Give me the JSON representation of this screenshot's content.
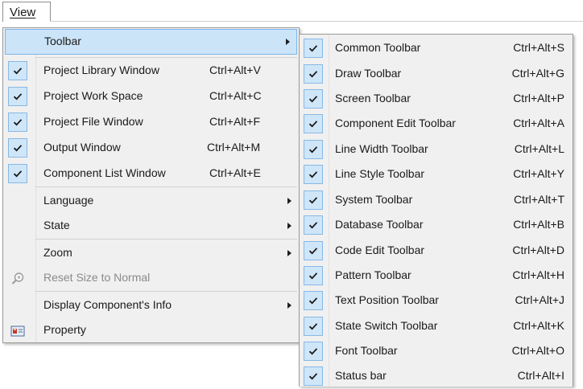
{
  "menubar": {
    "view": "View"
  },
  "main_menu": {
    "toolbar": "Toolbar",
    "items": [
      {
        "label": "Project Library Window",
        "shortcut": "Ctrl+Alt+V"
      },
      {
        "label": "Project Work Space",
        "shortcut": "Ctrl+Alt+C"
      },
      {
        "label": "Project File Window",
        "shortcut": "Ctrl+Alt+F"
      },
      {
        "label": "Output Window",
        "shortcut": "Ctrl+Alt+M"
      },
      {
        "label": "Component List Window",
        "shortcut": "Ctrl+Alt+E"
      }
    ],
    "language": "Language",
    "state": "State",
    "zoom": "Zoom",
    "reset_size": "Reset Size to Normal",
    "display_info": "Display Component's Info",
    "property": "Property"
  },
  "submenu": {
    "items": [
      {
        "label": "Common Toolbar",
        "shortcut": "Ctrl+Alt+S"
      },
      {
        "label": "Draw Toolbar",
        "shortcut": "Ctrl+Alt+G"
      },
      {
        "label": "Screen Toolbar",
        "shortcut": "Ctrl+Alt+P"
      },
      {
        "label": "Component Edit Toolbar",
        "shortcut": "Ctrl+Alt+A"
      },
      {
        "label": "Line Width Toolbar",
        "shortcut": "Ctrl+Alt+L"
      },
      {
        "label": "Line Style Toolbar",
        "shortcut": "Ctrl+Alt+Y"
      },
      {
        "label": "System Toolbar",
        "shortcut": "Ctrl+Alt+T"
      },
      {
        "label": "Database Toolbar",
        "shortcut": "Ctrl+Alt+B"
      },
      {
        "label": "Code Edit Toolbar",
        "shortcut": "Ctrl+Alt+D"
      },
      {
        "label": "Pattern Toolbar",
        "shortcut": "Ctrl+Alt+H"
      },
      {
        "label": "Text Position Toolbar",
        "shortcut": "Ctrl+Alt+J"
      },
      {
        "label": "State Switch Toolbar",
        "shortcut": "Ctrl+Alt+K"
      },
      {
        "label": "Font Toolbar",
        "shortcut": "Ctrl+Alt+O"
      },
      {
        "label": "Status bar",
        "shortcut": "Ctrl+Alt+I"
      }
    ]
  },
  "icons": {
    "check": "checkmark-icon",
    "zoom": "magnifier-icon",
    "property": "property-card-icon",
    "submenu": "submenu-arrow-icon"
  },
  "colors": {
    "highlight": "#cbe4f8",
    "highlight_border": "#7eb4ea",
    "check_box": "#cfe6f8",
    "disabled_text": "#8a8a8a"
  }
}
